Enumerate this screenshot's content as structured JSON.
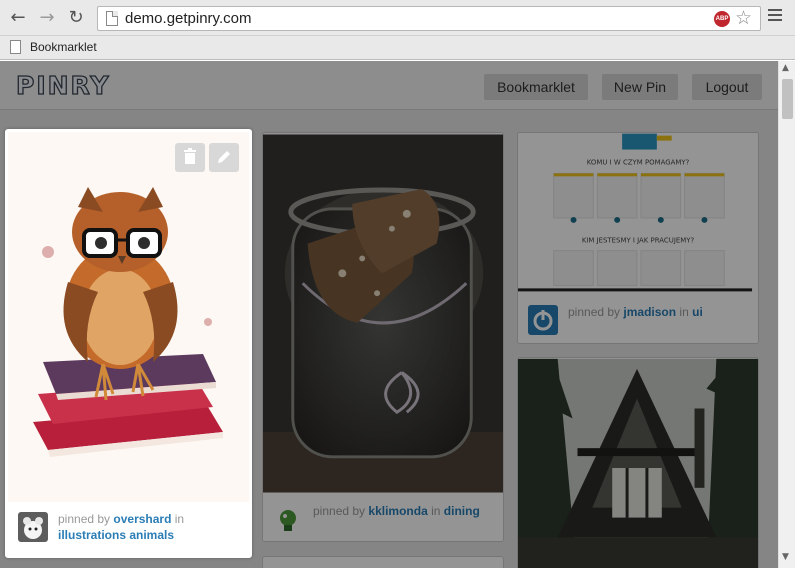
{
  "browser": {
    "url": "demo.getpinry.com",
    "adblock_label": "ABP",
    "back_icon": "back-arrow-icon",
    "forward_icon": "forward-arrow-icon",
    "reload_icon": "reload-icon",
    "bookmarks_bar": {
      "item": "Bookmarklet"
    }
  },
  "header": {
    "logo": "Pinry",
    "buttons": {
      "bookmarklet": "Bookmarklet",
      "new_pin": "New Pin",
      "logout": "Logout"
    }
  },
  "pins": [
    {
      "pinned_by_text": "pinned by",
      "user": "overshard",
      "in_text": "in",
      "tags": "illustrations animals",
      "image": "owl illustration on books"
    },
    {
      "pinned_by_text": "pinned by",
      "user": "kklimonda",
      "in_text": "in",
      "tags": "dining",
      "image": "biscotti in a glass jar"
    },
    {
      "pinned_by_text": "pinned by",
      "user": "jmadison",
      "in_text": "in",
      "tags": "ui",
      "image": "web page screenshot",
      "headings": [
        "KOMU I W CZYM POMAGAMY?",
        "KIM JESTESMY I JAK PRACUJEMY?"
      ]
    },
    {
      "image": "A-frame cabin in forest"
    }
  ],
  "colors": {
    "link": "#2a7db5",
    "muted": "#999999",
    "header_bg": "#f3f3f3",
    "page_bg": "#e5e5e5"
  }
}
